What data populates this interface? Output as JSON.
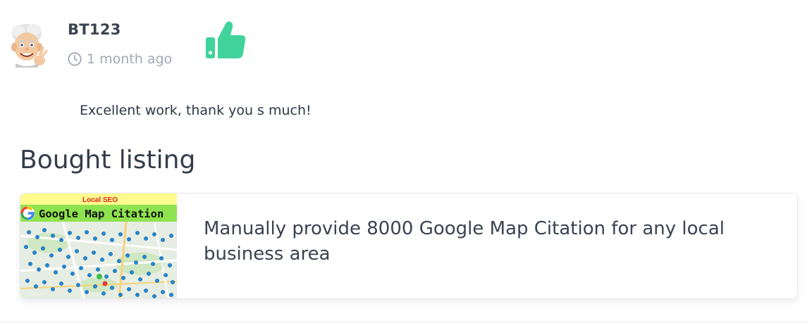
{
  "review": {
    "username": "BT123",
    "time_ago": "1 month ago",
    "rating_icon": "thumbs-up-icon",
    "rating_color": "#41d39c",
    "comment": "Excellent work, thank you s much!"
  },
  "section": {
    "title": "Bought listing"
  },
  "listing": {
    "title": "Manually provide 8000 Google Map Citation for any local business area",
    "thumbnail": {
      "tag": "Local SEO",
      "banner": "Google Map Citation",
      "tag_color": "#e02020",
      "banner_bg": "#8fe34e",
      "top_bg": "#fffb8f"
    }
  },
  "icons": {
    "clock": "clock-icon",
    "avatar": "avatar-image"
  }
}
